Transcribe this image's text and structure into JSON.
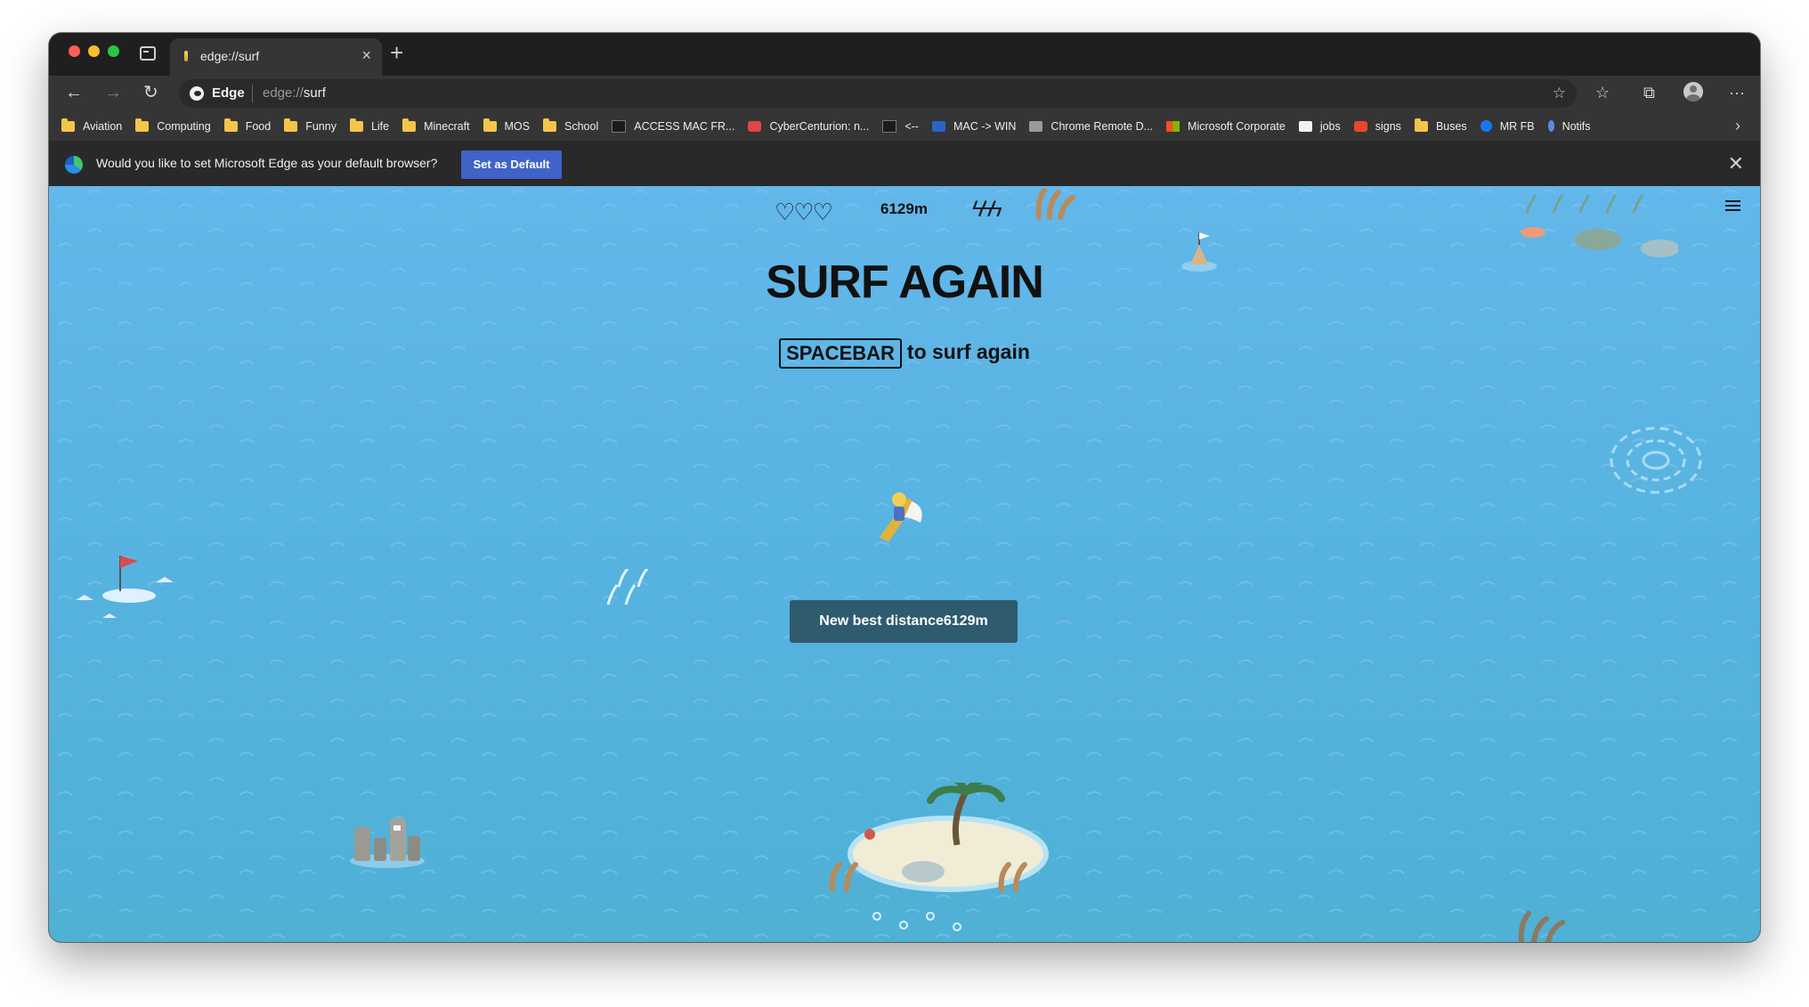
{
  "tab": {
    "title": "edge://surf",
    "close": "×",
    "new_tab": "+"
  },
  "toolbar": {
    "back": "←",
    "forward": "→",
    "reload": "↻",
    "brand": "Edge",
    "url_prefix": "edge://",
    "url_path": "surf",
    "fav_icon": "☆",
    "favorites_icon": "☆",
    "collections_icon": "⧉",
    "more_icon": "···"
  },
  "bookmarks": [
    {
      "label": "Aviation",
      "icon": "folder"
    },
    {
      "label": "Computing",
      "icon": "folder"
    },
    {
      "label": "Food",
      "icon": "folder"
    },
    {
      "label": "Funny",
      "icon": "folder"
    },
    {
      "label": "Life",
      "icon": "folder"
    },
    {
      "label": "Minecraft",
      "icon": "folder"
    },
    {
      "label": "MOS",
      "icon": "folder"
    },
    {
      "label": "School",
      "icon": "folder"
    },
    {
      "label": "ACCESS MAC FR...",
      "icon": "htg"
    },
    {
      "label": "CyberCenturion: n...",
      "icon": "red"
    },
    {
      "label": "<--",
      "icon": "htg"
    },
    {
      "label": "MAC -> WIN",
      "icon": "m"
    },
    {
      "label": "Chrome Remote D...",
      "icon": "remote"
    },
    {
      "label": "Microsoft Corporate",
      "icon": "ms"
    },
    {
      "label": "jobs",
      "icon": "jobs"
    },
    {
      "label": "signs",
      "icon": "signs"
    },
    {
      "label": "Buses",
      "icon": "folder"
    },
    {
      "label": "MR FB",
      "icon": "fb"
    },
    {
      "label": "Notifs",
      "icon": "notif"
    }
  ],
  "bookmarks_more": "›",
  "infobar": {
    "message": "Would you like to set Microsoft Edge as your default browser?",
    "button": "Set as Default",
    "close": "✕"
  },
  "game": {
    "hearts": "♡♡♡",
    "distance": "6129m",
    "bolts": "ϟϟϟ",
    "title": "SURF AGAIN",
    "key_label": "SPACEBAR",
    "subtitle_rest": "to surf again",
    "best_button": "New best distance6129m"
  },
  "colors": {
    "ocean": "#5ab4e2",
    "button": "#2f5b6e",
    "infobar_button": "#3f63c7"
  }
}
